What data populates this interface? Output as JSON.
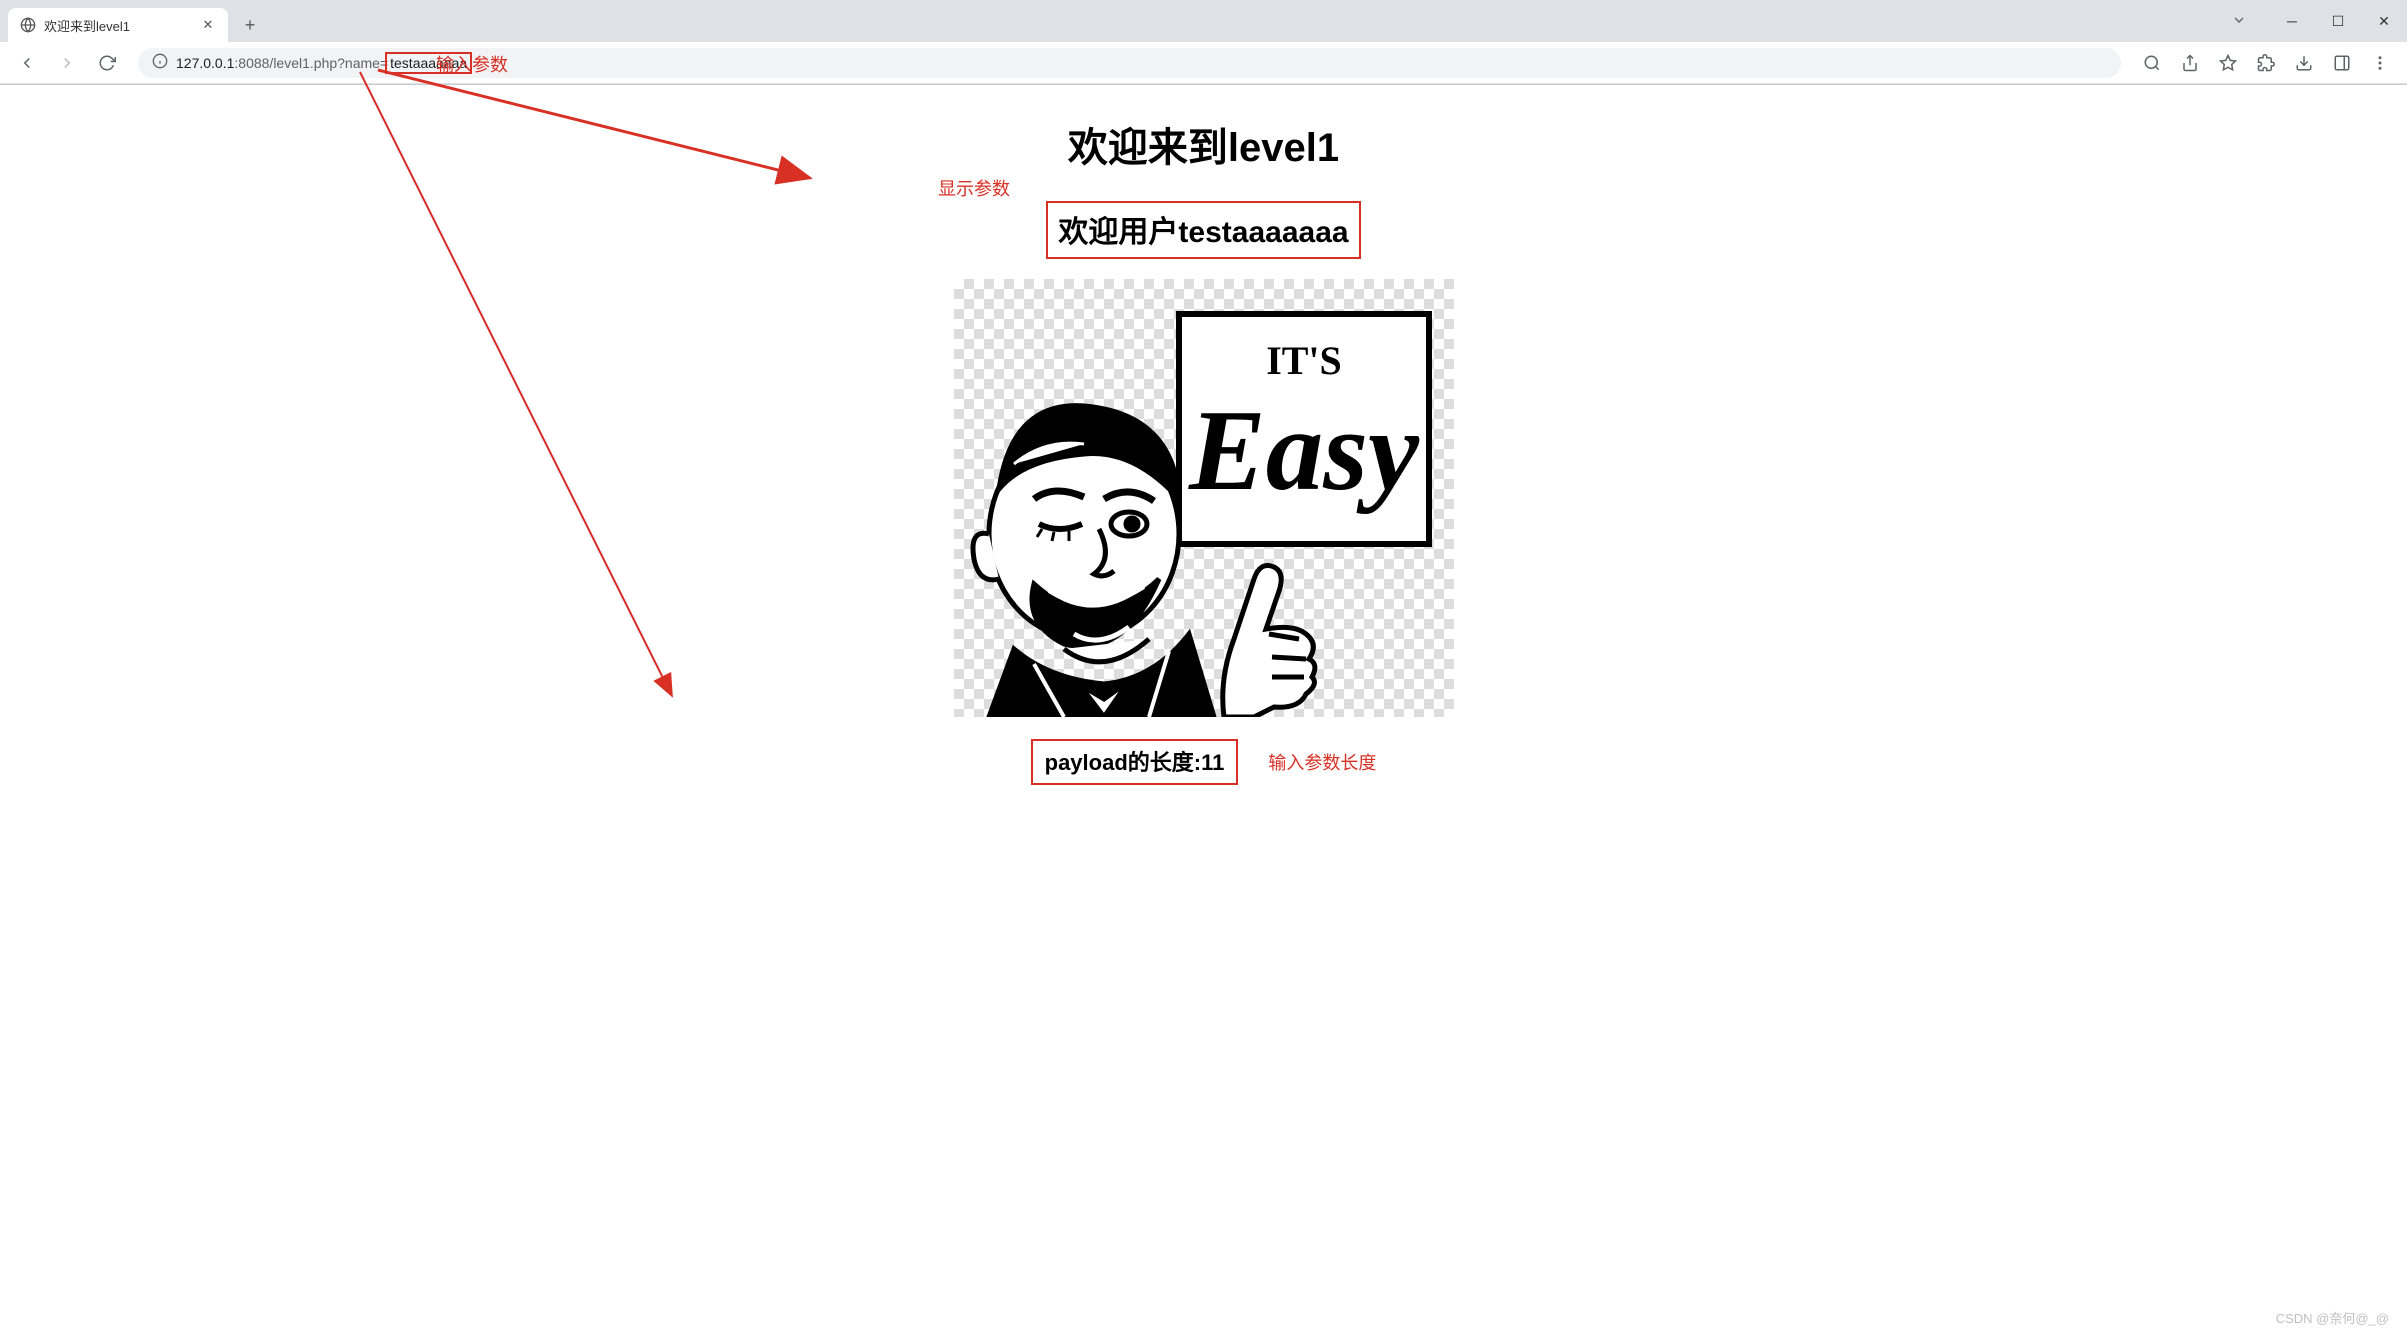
{
  "browser": {
    "tab_title": "欢迎来到level1",
    "url_prefix": "127.0.0.1",
    "url_port_path": ":8088/level1.php?name=",
    "url_param_value": "testaaaaaaa"
  },
  "page": {
    "heading": "欢迎来到level1",
    "welcome_prefix": "欢迎用户",
    "welcome_user": "testaaaaaaa",
    "payload_label": "payload的长度:",
    "payload_value": "11"
  },
  "annotations": {
    "input_param": "输入参数",
    "display_param": "显示参数",
    "length_label": "输入参数长度"
  },
  "watermark": "CSDN @奈何@_@",
  "image_text": {
    "its": "IT'S",
    "easy": "Easy"
  },
  "colors": {
    "annotation": "#d93025"
  }
}
